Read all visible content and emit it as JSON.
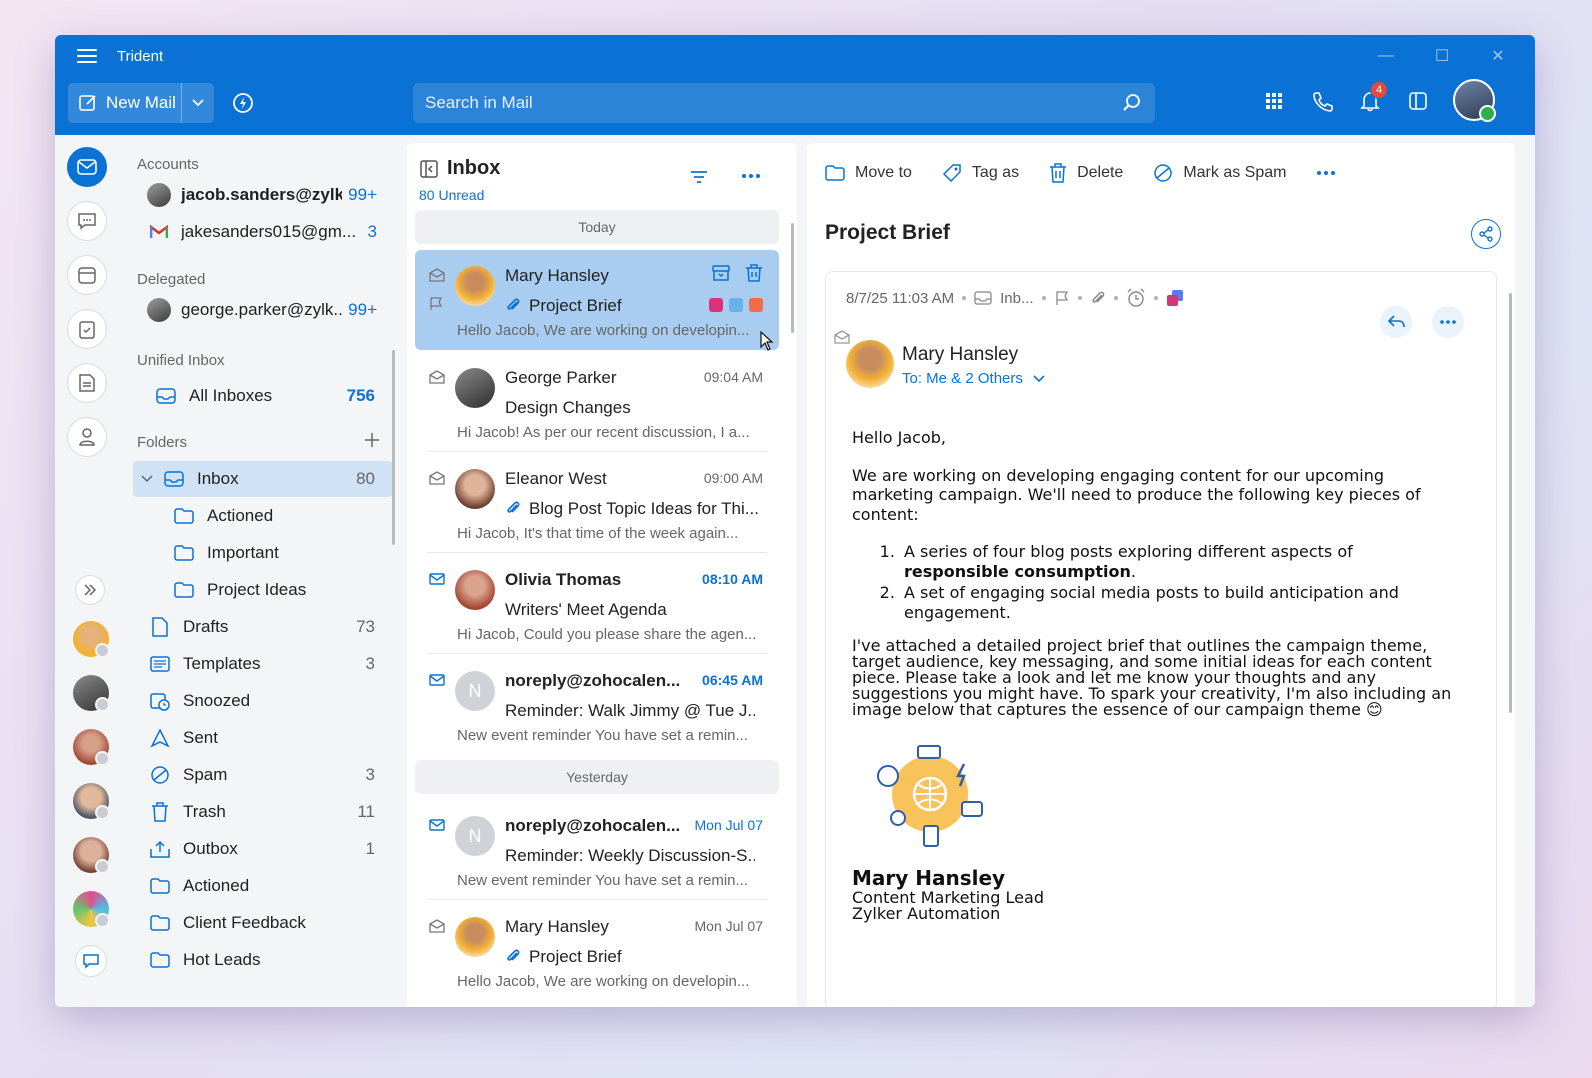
{
  "app": {
    "title": "Trident"
  },
  "toolbar": {
    "new_mail_label": "New Mail",
    "search_placeholder": "Search in Mail",
    "notification_count": "4"
  },
  "sidebar": {
    "accounts_title": "Accounts",
    "accounts": [
      {
        "name": "jacob.sanders@zylk...",
        "count": "99+",
        "bold": true
      },
      {
        "name": "jakesanders015@gm...",
        "count": "3",
        "bold": false
      }
    ],
    "delegated_title": "Delegated",
    "delegated": [
      {
        "name": "george.parker@zylk...",
        "count": "99+"
      }
    ],
    "unified_title": "Unified Inbox",
    "all_inboxes": {
      "label": "All Inboxes",
      "count": "756"
    },
    "folders_title": "Folders",
    "folders": [
      {
        "label": "Inbox",
        "count": "80"
      },
      {
        "label": "Actioned",
        "count": ""
      },
      {
        "label": "Important",
        "count": ""
      },
      {
        "label": "Project Ideas",
        "count": ""
      },
      {
        "label": "Drafts",
        "count": "73"
      },
      {
        "label": "Templates",
        "count": "3"
      },
      {
        "label": "Snoozed",
        "count": ""
      },
      {
        "label": "Sent",
        "count": ""
      },
      {
        "label": "Spam",
        "count": "3"
      },
      {
        "label": "Trash",
        "count": "11"
      },
      {
        "label": "Outbox",
        "count": "1"
      },
      {
        "label": "Actioned",
        "count": ""
      },
      {
        "label": "Client Feedback",
        "count": ""
      },
      {
        "label": "Hot Leads",
        "count": ""
      }
    ]
  },
  "list": {
    "title": "Inbox",
    "unread": "80 Unread",
    "sep_today": "Today",
    "sep_yesterday": "Yesterday",
    "messages": [
      {
        "from": "Mary Hansley",
        "time": "",
        "subject": "Project Brief",
        "preview": "Hello Jacob, We are working on developin...",
        "unread": false
      },
      {
        "from": "George Parker",
        "time": "09:04 AM",
        "subject": "Design Changes",
        "preview": "Hi Jacob! As per our recent discussion, I a...",
        "unread": false
      },
      {
        "from": "Eleanor West",
        "time": "09:00 AM",
        "subject": "Blog Post Topic Ideas for Thi...",
        "preview": "Hi Jacob, It's that time of the week again...",
        "unread": false
      },
      {
        "from": "Olivia Thomas",
        "time": "08:10 AM",
        "subject": "Writers' Meet Agenda",
        "preview": "Hi Jacob, Could you please share the agen...",
        "unread": true
      },
      {
        "from": "noreply@zohocalen...",
        "time": "06:45 AM",
        "subject": "Reminder: Walk Jimmy @ Tue J...",
        "preview": "New event reminder You have set a remin...",
        "unread": true,
        "initial": "N"
      },
      {
        "from": "noreply@zohocalen...",
        "time": "Mon Jul 07",
        "subject": "Reminder: Weekly Discussion-S...",
        "preview": "New event reminder You have set a remin...",
        "unread": true,
        "initial": "N"
      },
      {
        "from": "Mary Hansley",
        "time": "Mon Jul 07",
        "subject": "Project Brief",
        "preview": "Hello Jacob, We are working on developin...",
        "unread": false
      }
    ]
  },
  "reader": {
    "actions": {
      "move": "Move to",
      "tag": "Tag as",
      "delete": "Delete",
      "spam": "Mark as Spam"
    },
    "title": "Project Brief",
    "datetime": "8/7/25 11:03 AM",
    "folder_short": "Inb...",
    "sender": "Mary Hansley",
    "to": "To: Me & 2 Others",
    "body": {
      "greeting": "Hello Jacob,",
      "intro": "We are working on developing engaging content for our upcoming marketing campaign. We'll need to produce the following key pieces of content:",
      "item1_pre": "A series of four blog posts exploring different aspects of ",
      "item1_bold": "responsible consumption",
      "item1_post": ".",
      "item2": "A set of engaging social media posts to build anticipation and engagement.",
      "closing": "I've attached a detailed project brief that outlines the campaign theme, target audience, key messaging, and some initial ideas for each content piece. Please take a look and let me know your thoughts and any suggestions you might have. To spark your creativity, I'm also including an image below that captures the essence of our campaign theme 😊"
    },
    "signature": {
      "name": "Mary Hansley",
      "role": "Content Marketing Lead",
      "company": "Zylker Automation"
    }
  },
  "colors": {
    "accent": "#0a72d4",
    "selected_row": "#a9cdf0",
    "tag_pink": "#d6357a",
    "tag_blue": "#6ab0ea",
    "tag_orange": "#ef6b4a"
  }
}
